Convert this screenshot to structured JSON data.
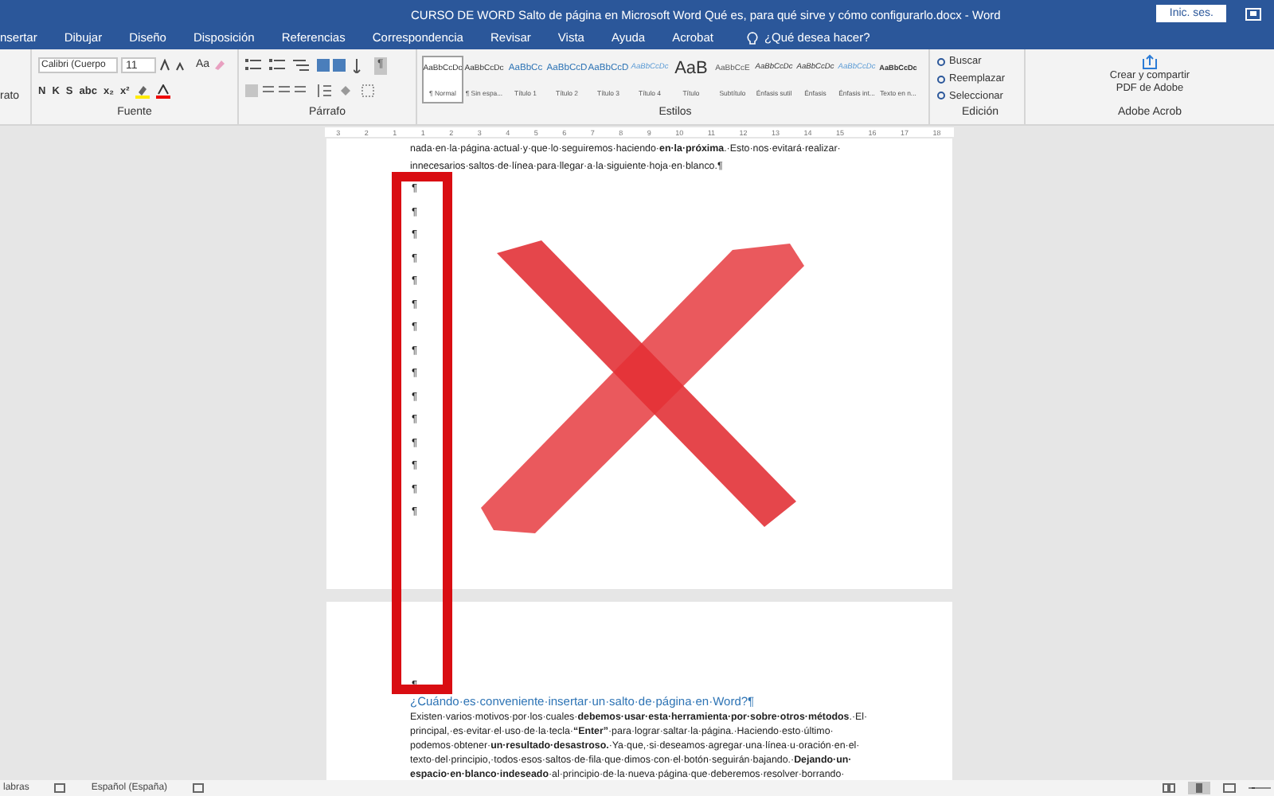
{
  "window": {
    "title": "CURSO DE WORD Salto de página en Microsoft Word Qué es, para qué sirve y cómo configurarlo.docx  -  Word",
    "sign_in": "Inic. ses."
  },
  "tabs": [
    {
      "label": "nsertar",
      "selected": false
    },
    {
      "label": "Dibujar",
      "selected": false
    },
    {
      "label": "Diseño",
      "selected": false
    },
    {
      "label": "Disposición",
      "selected": false
    },
    {
      "label": "Referencias",
      "selected": false
    },
    {
      "label": "Correspondencia",
      "selected": false
    },
    {
      "label": "Revisar",
      "selected": false
    },
    {
      "label": "Vista",
      "selected": false
    },
    {
      "label": "Ayuda",
      "selected": false
    },
    {
      "label": "Acrobat",
      "selected": false
    }
  ],
  "tell_me": {
    "placeholder": "¿Qué desea hacer?"
  },
  "ribbon": {
    "clipboard_label": "rato",
    "font_name": "Calibri (Cuerpo",
    "font_size": "11",
    "case_button": "Aa",
    "font_buttons": [
      "N",
      "K",
      "S",
      "abc",
      "x₂",
      "x²"
    ],
    "groups": [
      "Fuente",
      "Párrafo",
      "Estilos",
      "Edición",
      "Adobe Acrob"
    ],
    "show_marks": {
      "on": true
    },
    "styles": [
      {
        "preview": "AaBbCcDc",
        "name": "¶ Normal",
        "selected": true,
        "kind": "normal"
      },
      {
        "preview": "AaBbCcDc",
        "name": "¶ Sin espa...",
        "selected": false,
        "kind": "normal"
      },
      {
        "preview": "AaBbCc",
        "name": "Título 1",
        "selected": false,
        "kind": "heading"
      },
      {
        "preview": "AaBbCcD",
        "name": "Título 2",
        "selected": false,
        "kind": "heading"
      },
      {
        "preview": "AaBbCcD",
        "name": "Título 3",
        "selected": false,
        "kind": "heading"
      },
      {
        "preview": "AaBbCcDc",
        "name": "Título 4",
        "selected": false,
        "kind": "italic-blue"
      },
      {
        "preview": "AaB",
        "name": "Título",
        "selected": false,
        "kind": "title"
      },
      {
        "preview": "AaBbCcE",
        "name": "Subtítulo",
        "selected": false,
        "kind": "subtle"
      },
      {
        "preview": "AaBbCcDc",
        "name": "Énfasis sutil",
        "selected": false,
        "kind": "italic"
      },
      {
        "preview": "AaBbCcDc",
        "name": "Énfasis",
        "selected": false,
        "kind": "italic"
      },
      {
        "preview": "AaBbCcDc",
        "name": "Énfasis int...",
        "selected": false,
        "kind": "italic-blue"
      },
      {
        "preview": "AaBbCcDc",
        "name": "Texto en n...",
        "selected": false,
        "kind": "bold"
      }
    ],
    "editing": [
      "Buscar",
      "Reemplazar",
      "Seleccionar"
    ],
    "adobe_button": "Crear y compartir PDF de Adobe"
  },
  "ruler": [
    "3",
    "2",
    "1",
    "1",
    "2",
    "3",
    "4",
    "5",
    "6",
    "7",
    "8",
    "9",
    "10",
    "11",
    "12",
    "13",
    "14",
    "15",
    "16",
    "17",
    "18"
  ],
  "page1": {
    "lines": [
      "nada·en·la·página·actual·y·que·lo·seguiremos·haciendo·**en·la·próxima**.·Esto·nos·evitará·realizar·",
      "innecesarios·saltos·de·línea·para·llegar·a·la·siguiente·hoja·en·blanco.¶"
    ],
    "marks": [
      "¶",
      "¶",
      "¶",
      "¶",
      "¶",
      "¶",
      "¶",
      "¶",
      "¶",
      "¶",
      "¶",
      "¶",
      "¶",
      "¶",
      "¶"
    ]
  },
  "page2": {
    "mark": "¶",
    "heading": "¿Cuándo·es·conveniente·insertar·un·salto·de·página·en·Word?¶",
    "lines": [
      "Existen·varios·motivos·por·los·cuales·**debemos·usar·esta·herramienta·por·sobre·otros·métodos**.·El·",
      "principal,·es·evitar·el·uso·de·la·tecla·**“Enter”**·para·lograr·saltar·la·página.·Haciendo·esto·último·",
      "podemos·obtener·**un·resultado·desastroso.**·Ya·que,·si·deseamos·agregar·una·línea·u·oración·en·el·",
      "texto·del·principio,·todos·esos·saltos·de·fila·que·dimos·con·el·botón·seguirán·bajando.·**Dejando·un·**",
      "**espacio·en·blanco·indeseado**·al·principio·de·la·nueva·página·que·deberemos·resolver·borrando·"
    ]
  },
  "status_bar": {
    "words": "labras",
    "language": "Español (España)"
  }
}
